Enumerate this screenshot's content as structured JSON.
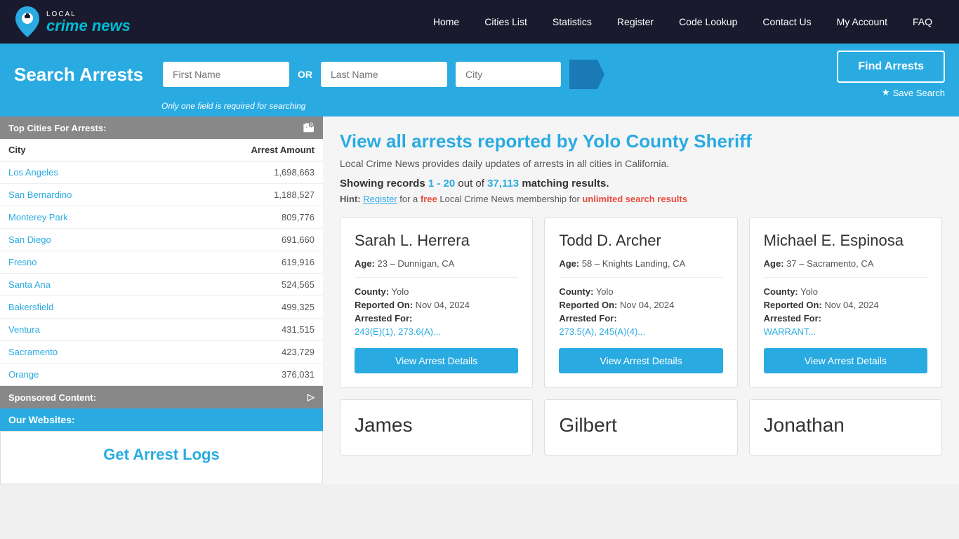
{
  "nav": {
    "brand": "crime news",
    "brand_local": "LOCAL",
    "links": [
      "Home",
      "Cities List",
      "Statistics",
      "Register",
      "Code Lookup",
      "Contact Us",
      "My Account",
      "FAQ"
    ]
  },
  "search": {
    "title": "Search Arrests",
    "first_name_placeholder": "First Name",
    "or_text": "OR",
    "last_name_placeholder": "Last Name",
    "city_placeholder": "City",
    "hint": "Only one field is required for searching",
    "find_button": "Find Arrests",
    "save_search": "Save Search"
  },
  "page": {
    "heading": "View all arrests reported by Yolo County Sheriff",
    "subtext": "Local Crime News provides daily updates of arrests in all cities in California.",
    "records_label": "Showing records",
    "records_range": "1 - 20",
    "records_out_of": "out of",
    "records_total": "37,113",
    "records_suffix": "matching results.",
    "hint_prefix": "Hint:",
    "hint_register": "Register",
    "hint_free": "free",
    "hint_middle": "Local Crime News membership for",
    "hint_unlimited": "unlimited search results"
  },
  "sidebar": {
    "top_cities_title": "Top Cities For Arrests:",
    "col_city": "City",
    "col_arrests": "Arrest Amount",
    "cities": [
      {
        "name": "Los Angeles",
        "arrests": "1,698,663"
      },
      {
        "name": "San Bernardino",
        "arrests": "1,188,527"
      },
      {
        "name": "Monterey Park",
        "arrests": "809,776"
      },
      {
        "name": "San Diego",
        "arrests": "691,660"
      },
      {
        "name": "Fresno",
        "arrests": "619,916"
      },
      {
        "name": "Santa Ana",
        "arrests": "524,565"
      },
      {
        "name": "Bakersfield",
        "arrests": "499,325"
      },
      {
        "name": "Ventura",
        "arrests": "431,515"
      },
      {
        "name": "Sacramento",
        "arrests": "423,729"
      },
      {
        "name": "Orange",
        "arrests": "376,031"
      }
    ],
    "sponsored_title": "Sponsored Content:",
    "our_websites": "Our Websites:",
    "get_arrest_logs": "Get Arrest Logs"
  },
  "cards": [
    {
      "name": "Sarah L. Herrera",
      "age": "23",
      "location": "Dunnigan, CA",
      "county": "Yolo",
      "reported": "Nov 04, 2024",
      "charges": "243(E)(1), 273.6(A)...",
      "btn": "View Arrest Details"
    },
    {
      "name": "Todd D. Archer",
      "age": "58",
      "location": "Knights Landing, CA",
      "county": "Yolo",
      "reported": "Nov 04, 2024",
      "charges": "273.5(A), 245(A)(4)...",
      "btn": "View Arrest Details"
    },
    {
      "name": "Michael E. Espinosa",
      "age": "37",
      "location": "Sacramento, CA",
      "county": "Yolo",
      "reported": "Nov 04, 2024",
      "charges": "WARRANT...",
      "btn": "View Arrest Details"
    }
  ],
  "partial_cards": [
    {
      "name": "James"
    },
    {
      "name": "Gilbert"
    },
    {
      "name": "Jonathan"
    }
  ]
}
